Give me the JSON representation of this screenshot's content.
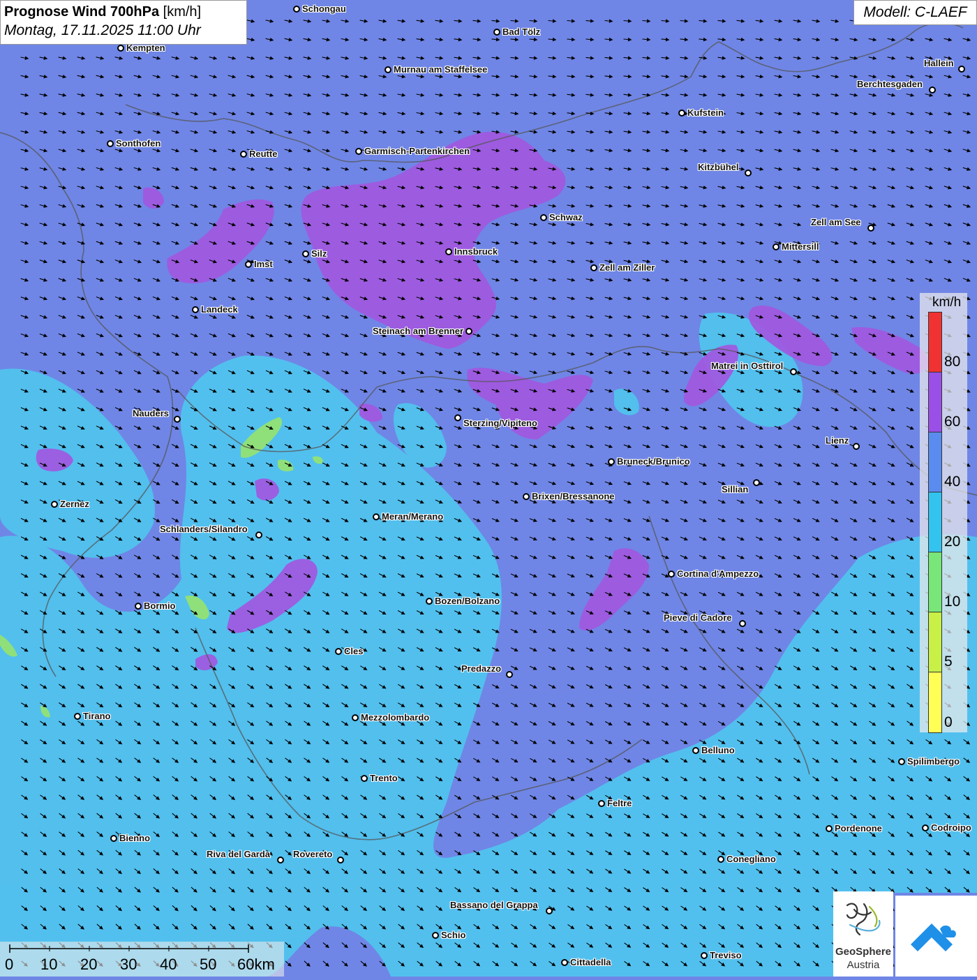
{
  "title": {
    "main": "Prognose Wind 700hPa",
    "unit": "[km/h]",
    "subtitle": "Montag, 17.11.2025 11:00 Uhr"
  },
  "model_label": "Modell: C-LAEF",
  "legend": {
    "unit": "km/h",
    "steps": [
      {
        "label": "0",
        "color": "#ffff55"
      },
      {
        "label": "5",
        "color": "#c8f046"
      },
      {
        "label": "10",
        "color": "#78e678"
      },
      {
        "label": "20",
        "color": "#32c3ef"
      },
      {
        "label": "40",
        "color": "#5a8cef"
      },
      {
        "label": "60",
        "color": "#9a50e6"
      },
      {
        "label": "80",
        "color": "#f03232"
      }
    ]
  },
  "scale_bar": {
    "labels": [
      "0",
      "10",
      "20",
      "30",
      "40",
      "50",
      "60km"
    ]
  },
  "logos": {
    "geosphere_line1": "GeoSphere",
    "geosphere_line2": "Austria"
  },
  "colors": {
    "background": "#6f86e6",
    "wind_20_40": "#4fc6ee",
    "wind_60_80": "#a158e0",
    "wind_10_20": "#8fe07a",
    "arrow": "#000000"
  },
  "wind_field": {
    "prevailing_direction": "northwest",
    "arrow_style": "small black arrows"
  },
  "cities": [
    {
      "name": "Schongau"
    },
    {
      "name": "Bad Tölz"
    },
    {
      "name": "Kempten"
    },
    {
      "name": "Murnau am Staffelsee"
    },
    {
      "name": "Hallein"
    },
    {
      "name": "Berchtesgaden"
    },
    {
      "name": "Kufstein"
    },
    {
      "name": "Sonthofen"
    },
    {
      "name": "Reutte"
    },
    {
      "name": "Garmisch-Partenkirchen"
    },
    {
      "name": "Kitzbühel"
    },
    {
      "name": "Schwaz"
    },
    {
      "name": "Zell am See"
    },
    {
      "name": "Mittersill"
    },
    {
      "name": "Silz"
    },
    {
      "name": "Innsbruck"
    },
    {
      "name": "Imst"
    },
    {
      "name": "Zell am Ziller"
    },
    {
      "name": "Landeck"
    },
    {
      "name": "Steinach am Brenner"
    },
    {
      "name": "Matrei in Osttirol"
    },
    {
      "name": "Nauders"
    },
    {
      "name": "Sterzing/Vipiteno"
    },
    {
      "name": "Lienz"
    },
    {
      "name": "Bruneck/Brunico"
    },
    {
      "name": "Sillian"
    },
    {
      "name": "Zernez"
    },
    {
      "name": "Brixen/Bressanone"
    },
    {
      "name": "Meran/Merano"
    },
    {
      "name": "Schlanders/Silandro"
    },
    {
      "name": "Cortina d'Ampezzo"
    },
    {
      "name": "Bozen/Bolzano"
    },
    {
      "name": "Bormio"
    },
    {
      "name": "Pieve di Cadore"
    },
    {
      "name": "Cles"
    },
    {
      "name": "Predazzo"
    },
    {
      "name": "Tirano"
    },
    {
      "name": "Mezzolombardo"
    },
    {
      "name": "Belluno"
    },
    {
      "name": "Spilimbergo"
    },
    {
      "name": "Trento"
    },
    {
      "name": "Feltre"
    },
    {
      "name": "Bienno"
    },
    {
      "name": "Pordenone"
    },
    {
      "name": "Codroipo"
    },
    {
      "name": "Riva del Garda"
    },
    {
      "name": "Rovereto"
    },
    {
      "name": "Conegliano"
    },
    {
      "name": "Bassano del Grappa"
    },
    {
      "name": "Schio"
    },
    {
      "name": "Treviso"
    },
    {
      "name": "Cittadella"
    }
  ]
}
